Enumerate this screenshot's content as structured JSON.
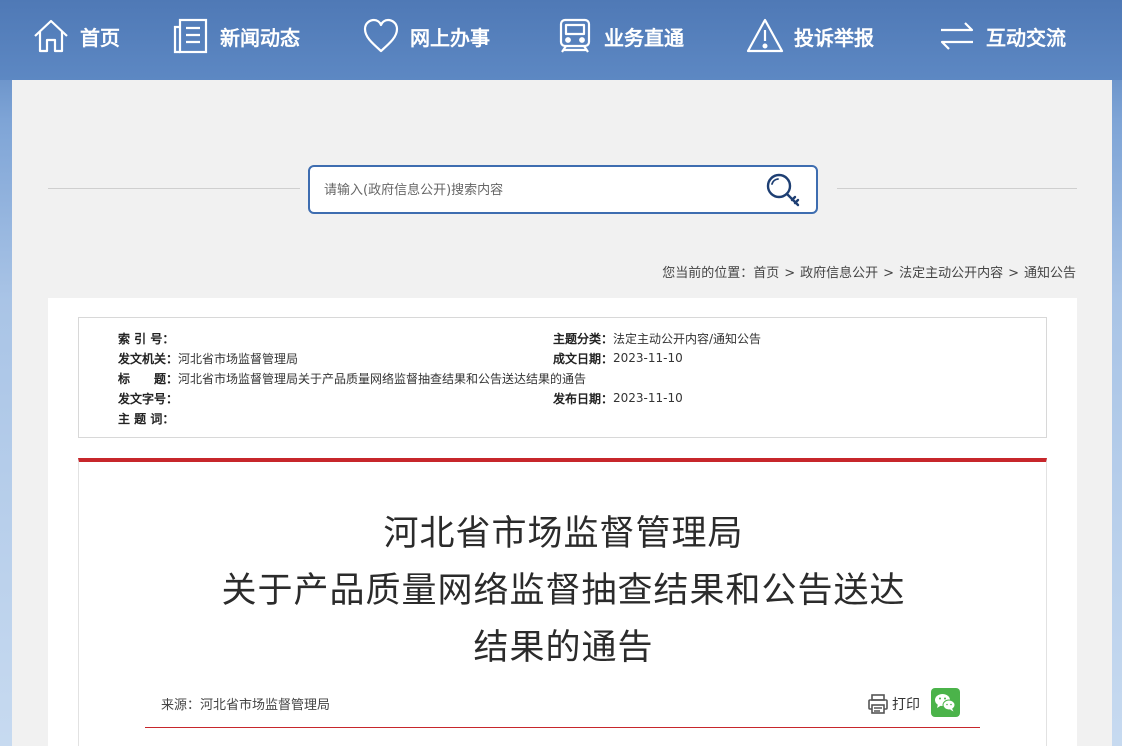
{
  "nav": {
    "items": [
      {
        "label": "首页",
        "icon": "home-icon"
      },
      {
        "label": "新闻动态",
        "icon": "news-icon"
      },
      {
        "label": "网上办事",
        "icon": "heart-icon"
      },
      {
        "label": "业务直通",
        "icon": "train-icon"
      },
      {
        "label": "投诉举报",
        "icon": "warning-icon"
      },
      {
        "label": "互动交流",
        "icon": "exchange-icon"
      }
    ]
  },
  "search": {
    "placeholder": "请输入(政府信息公开)搜索内容",
    "icon": "search-key-icon"
  },
  "breadcrumb": {
    "prefix": "您当前的位置：",
    "items": [
      "首页",
      "政府信息公开",
      "法定主动公开内容",
      "通知公告"
    ],
    "separator": ">"
  },
  "meta": {
    "index_no": {
      "label": "索 引 号：",
      "value": ""
    },
    "category": {
      "label": "主题分类：",
      "value": "法定主动公开内容/通知公告"
    },
    "issuer": {
      "label": "发文机关：",
      "value": "河北省市场监督管理局"
    },
    "created": {
      "label": "成文日期：",
      "value": "2023-11-10"
    },
    "subject": {
      "label": "标　　题：",
      "value": "河北省市场监督管理局关于产品质量网络监督抽查结果和公告送达结果的通告"
    },
    "doc_no": {
      "label": "发文字号：",
      "value": ""
    },
    "published": {
      "label": "发布日期：",
      "value": "2023-11-10"
    },
    "keywords": {
      "label": "主 题 词：",
      "value": ""
    }
  },
  "article": {
    "title_lines": [
      "河北省市场监督管理局",
      "关于产品质量网络监督抽查结果和公告送达",
      "结果的通告"
    ],
    "source": "来源：河北省市场监督管理局",
    "print_label": "打印"
  },
  "colors": {
    "nav_bg": "#4f79b6",
    "accent_blue": "#3e6db0",
    "accent_red": "#c7262b",
    "wechat_green": "#4bb34a"
  }
}
